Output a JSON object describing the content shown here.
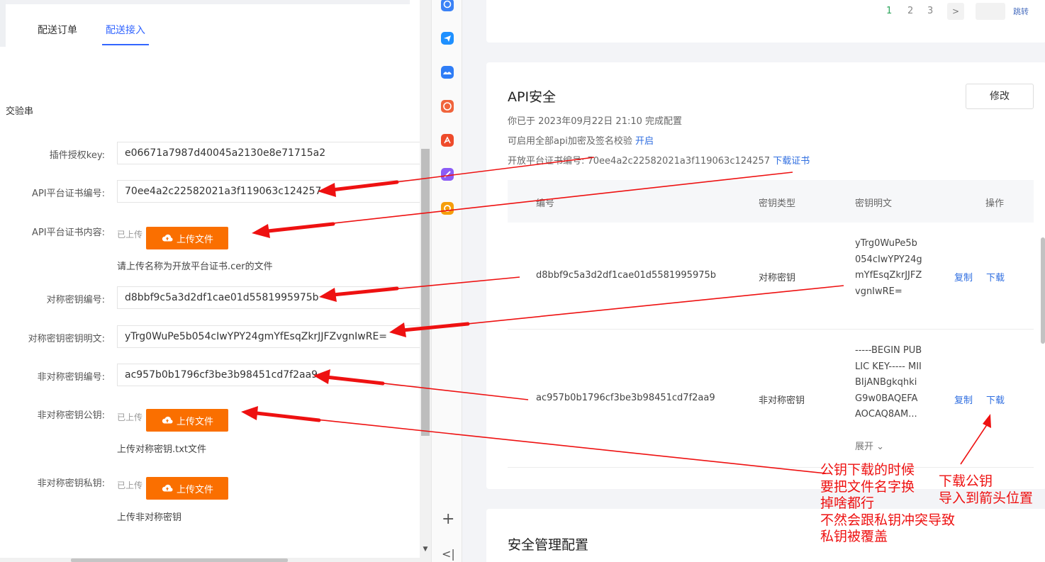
{
  "tabs": [
    {
      "label": "配送订单"
    },
    {
      "label": "配送接入"
    }
  ],
  "section_head": "交验串",
  "form": {
    "plugin_key_label": "插件授权key:",
    "plugin_key_value": "e06671a7987d40045a2130e8e71715a2",
    "cert_no_label": "API平台证书编号:",
    "cert_no_value": "70ee4a2c22582021a3f119063c124257",
    "cert_content_label": "API平台证书内容:",
    "uploaded_text": "已上传",
    "upload_button": "上传文件",
    "cert_hint": "请上传名称为开放平台证书.cer的文件",
    "sym_no_label": "对称密钥编号:",
    "sym_no_value": "d8bbf9c5a3d2df1cae01d5581995975b",
    "sym_plain_label": "对称密钥密钥明文:",
    "sym_plain_value": "yTrg0WuPe5b054cIwYPY24gmYfEsqZkrJJFZvgnIwRE=",
    "asym_no_label": "非对称密钥编号:",
    "asym_no_value": "ac957b0b1796cf3be3b98451cd7f2aa9",
    "asym_pub_label": "非对称密钥公钥:",
    "asym_pub_hint": "上传对称密钥.txt文件",
    "asym_priv_label": "非对称密钥私钥:",
    "asym_priv_hint": "上传非对称密钥"
  },
  "pagination": {
    "pages": [
      "1",
      "2",
      "3"
    ],
    "next": ">",
    "jump_label": "跳转"
  },
  "api_security": {
    "title": "API安全",
    "configured_text": "你已于 2023年09月22日 21:10 完成配置",
    "enable_text": "可启用全部api加密及签名校验",
    "enable_link": "开启",
    "cert_no_text": "开放平台证书编号: 70ee4a2c22582021a3f119063c124257",
    "download_cert": "下载证书",
    "edit_button": "修改",
    "table": {
      "headers": [
        "编号",
        "密钥类型",
        "密钥明文",
        "操作"
      ],
      "rows": [
        {
          "id": "d8bbf9c5a3d2df1cae01d5581995975b",
          "type": "对称密钥",
          "plain": "yTrg0WuPe5b054cIwYPY24gmYfEsqZkrJJFZvgnIwRE=",
          "copy": "复制",
          "download": "下载"
        },
        {
          "id": "ac957b0b1796cf3be3b98451cd7f2aa9",
          "type": "非对称密钥",
          "plain": "-----BEGIN PUBLIC KEY----- MIIBIjANBgkqhkiG9w0BAQEFAAOCAQ8AM...",
          "expand": "展开",
          "copy": "复制",
          "download": "下载"
        }
      ]
    }
  },
  "security_management_title": "安全管理配置",
  "annotations": {
    "note_left": [
      "公钥下载的时候",
      "要把文件名字换",
      "掉啥都行",
      "不然会跟私钥冲突导致",
      "私钥被覆盖"
    ],
    "note_right": [
      "下载公钥",
      "导入到箭头位置"
    ],
    "color": "#ee1111"
  },
  "colors": {
    "accent": "#3366ff",
    "upload_button": "#fa6f00",
    "link": "#2f6ee0",
    "page_current": "#2ca55b"
  }
}
